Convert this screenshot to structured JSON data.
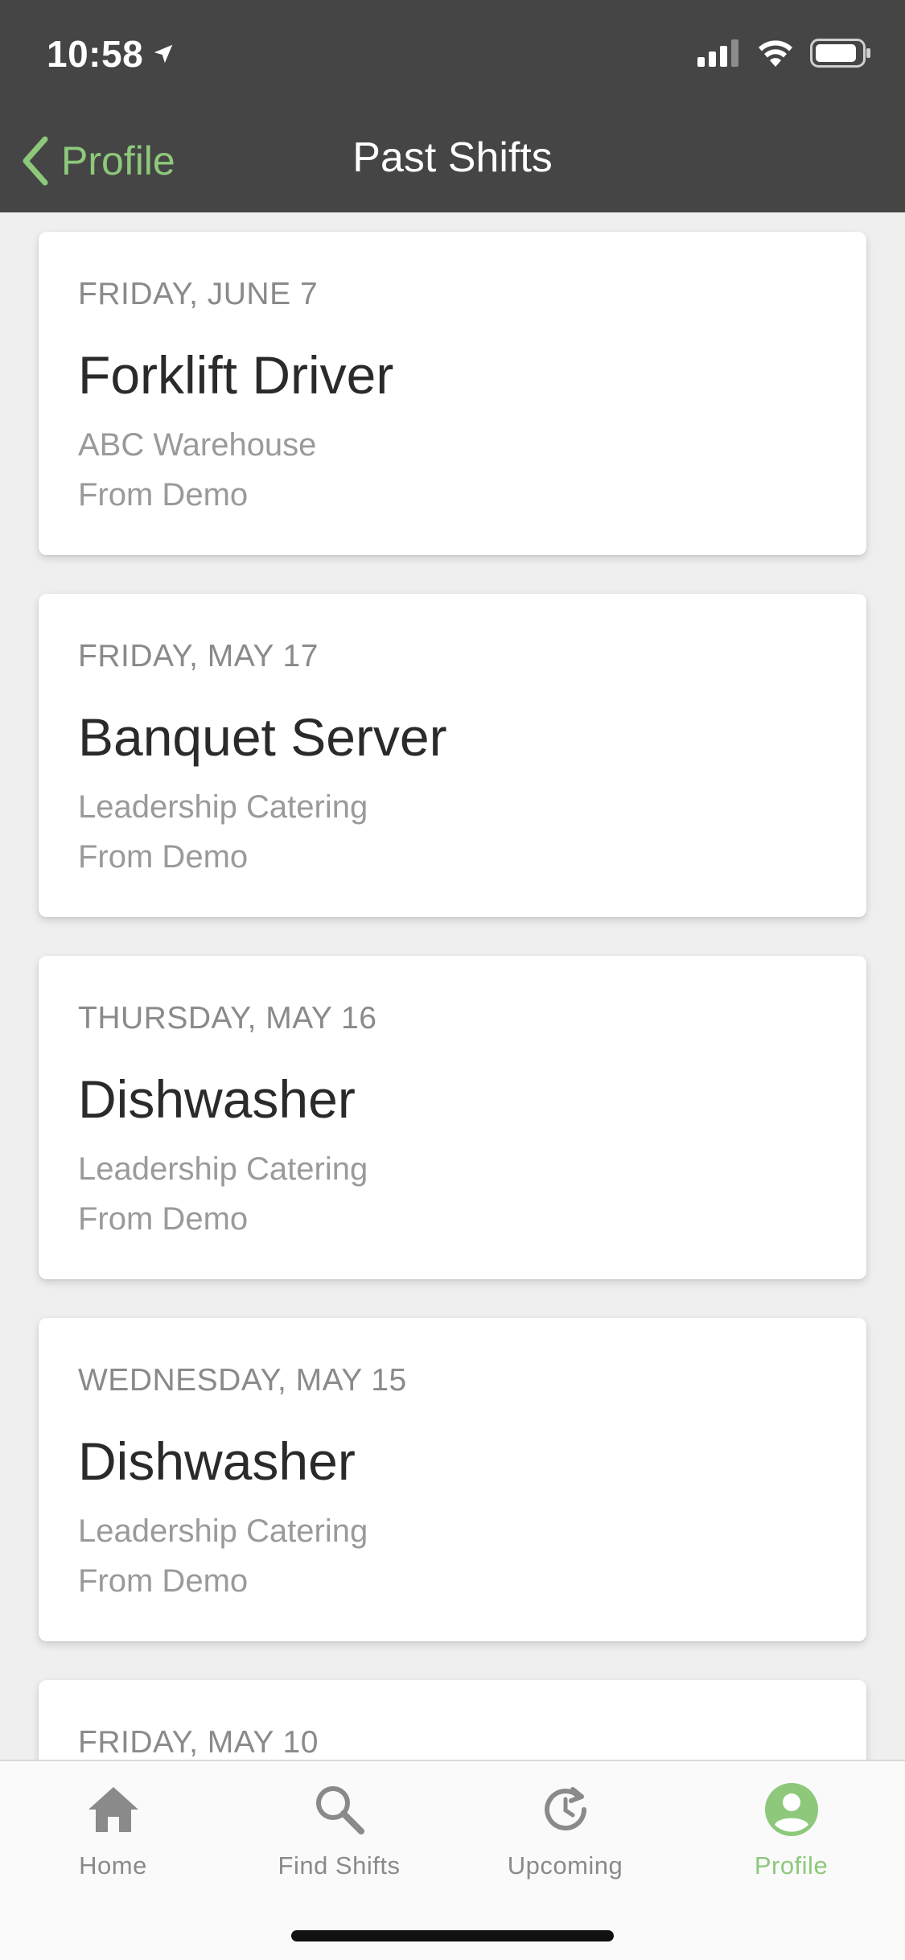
{
  "status_bar": {
    "time": "10:58",
    "location_icon": "location-arrow-icon",
    "signal_icon": "cellular-signal-icon",
    "wifi_icon": "wifi-icon",
    "battery_icon": "battery-icon"
  },
  "nav": {
    "back_label": "Profile",
    "back_icon": "chevron-left-icon",
    "title": "Past Shifts"
  },
  "shifts": [
    {
      "date": "FRIDAY, JUNE 7",
      "title": "Forklift Driver",
      "company": "ABC Warehouse",
      "source": "From Demo"
    },
    {
      "date": "FRIDAY, MAY 17",
      "title": "Banquet Server",
      "company": "Leadership Catering",
      "source": "From Demo"
    },
    {
      "date": "THURSDAY, MAY 16",
      "title": "Dishwasher",
      "company": "Leadership Catering",
      "source": "From Demo"
    },
    {
      "date": "WEDNESDAY, MAY 15",
      "title": "Dishwasher",
      "company": "Leadership Catering",
      "source": "From Demo"
    },
    {
      "date": "FRIDAY, MAY 10",
      "title": "",
      "company": "",
      "source": ""
    }
  ],
  "tabs": [
    {
      "label": "Home",
      "icon": "home-icon",
      "active": false
    },
    {
      "label": "Find Shifts",
      "icon": "search-icon",
      "active": false
    },
    {
      "label": "Upcoming",
      "icon": "clock-history-icon",
      "active": false
    },
    {
      "label": "Profile",
      "icon": "profile-icon",
      "active": true
    }
  ],
  "colors": {
    "accent": "#8dc87b",
    "header_bg": "#454545",
    "background": "#efefef",
    "inactive_tab": "#8a8a8a"
  }
}
